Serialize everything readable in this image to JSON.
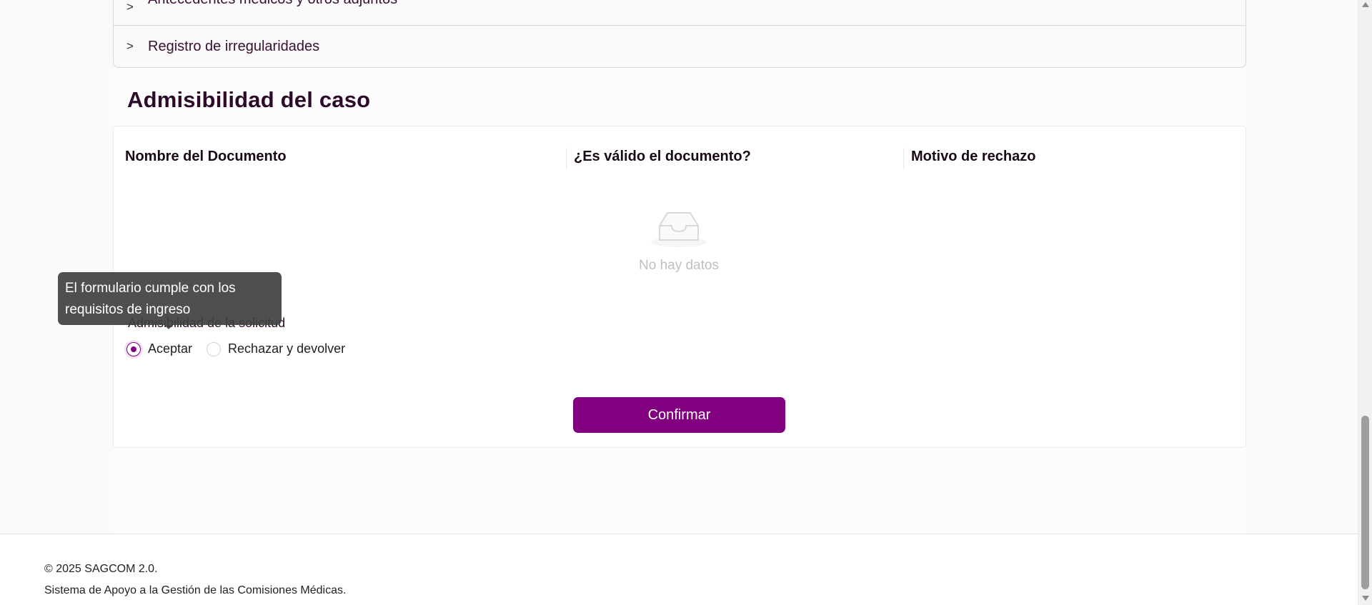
{
  "collapse": {
    "items": [
      {
        "label": "Antecedentes médicos y otros adjuntos"
      },
      {
        "label": "Registro de irregularidades"
      }
    ]
  },
  "section": {
    "title": "Admisibilidad del caso"
  },
  "table": {
    "columns": [
      "Nombre del Documento",
      "¿Es válido el documento?",
      "Motivo de rechazo"
    ],
    "empty_text": "No hay datos"
  },
  "admisibility": {
    "label": "Admisibilidad de la solicitud",
    "options": [
      "Aceptar",
      "Rechazar y devolver"
    ],
    "selected": "Aceptar"
  },
  "tooltip": {
    "text": "El formulario cumple con los requisitos de ingreso"
  },
  "confirm_label": "Confirmar",
  "footer": {
    "line1": "© 2025 SAGCOM 2.0.",
    "line2": "Sistema de Apoyo a la Gestión de las Comisiones Médicas."
  },
  "colors": {
    "accent": "#800080",
    "title": "#2e0a2a"
  }
}
